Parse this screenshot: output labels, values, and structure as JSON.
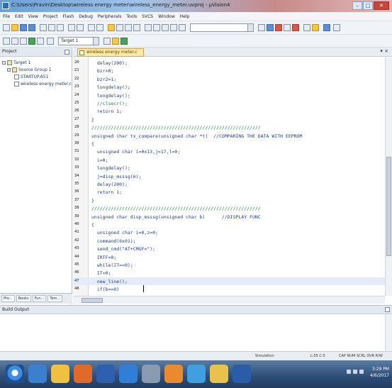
{
  "window": {
    "title": "C:\\Users\\Pravin\\Desktop\\wireless energy meter\\wireless_energy_meter.uvproj - µVision4"
  },
  "menu": [
    "File",
    "Edit",
    "View",
    "Project",
    "Flash",
    "Debug",
    "Peripherals",
    "Tools",
    "SVCS",
    "Window",
    "Help"
  ],
  "toolbar": {
    "target_combo": "Target 1"
  },
  "project": {
    "header": "Project",
    "tree": [
      {
        "label": "Target 1",
        "depth": 0
      },
      {
        "label": "Source Group 1",
        "depth": 1
      },
      {
        "label": "STARTUP.A51",
        "depth": 2
      },
      {
        "label": "wireless energy meter.c",
        "depth": 2
      }
    ],
    "tabs": [
      "Pro...",
      "Books",
      "Fun...",
      "Tem..."
    ]
  },
  "editor": {
    "tab": "wireless energy meter.c",
    "lines": [
      {
        "ln": "20",
        "text": "  delay(200);"
      },
      {
        "ln": "21",
        "text": "  bzr=0;"
      },
      {
        "ln": "22",
        "text": "  bzr2=1;"
      },
      {
        "ln": "23",
        "text": "  longdelay();"
      },
      {
        "ln": "24",
        "text": "  longdelay();"
      },
      {
        "ln": "25",
        "text": "  //clsecr();",
        "comment": true
      },
      {
        "ln": "26",
        "text": "  return 1;"
      },
      {
        "ln": "27",
        "text": "}"
      },
      {
        "ln": "28",
        "text": "/////////////////////////////////////////////////////////////",
        "comment": true
      },
      {
        "ln": "29",
        "text": "unsigned char tx_compare(unsigned char *t)  //COMPARING THE DATA WITH EEPROM",
        "comment_from": 42
      },
      {
        "ln": "30",
        "text": "{"
      },
      {
        "ln": "31",
        "text": "  unsigned char i=0x13,j=17,l=0;"
      },
      {
        "ln": "32",
        "text": "  i=0;"
      },
      {
        "ln": "33",
        "text": "  longdelay();"
      },
      {
        "ln": "34",
        "text": "  j=disp_msssg(m);"
      },
      {
        "ln": "35",
        "text": "  delay(200);"
      },
      {
        "ln": "36",
        "text": "  return 1;"
      },
      {
        "ln": "37",
        "text": "}"
      },
      {
        "ln": "38",
        "text": "/////////////////////////////////////////////////////////////",
        "comment": true
      },
      {
        "ln": "39",
        "text": "unsigned char disp_msssg(unsigned char b)      //DISPLAY FUNC",
        "comment_from": 46
      },
      {
        "ln": "40",
        "text": "{"
      },
      {
        "ln": "41",
        "text": "  unsigned char i=0,z=0;"
      },
      {
        "ln": "42",
        "text": "  command(0x01);"
      },
      {
        "ln": "43",
        "text": "  send_cmd(\"AT+CMGF=\");"
      },
      {
        "ln": "44",
        "text": "  IRTF=0;"
      },
      {
        "ln": "45",
        "text": "  while(IT==0);"
      },
      {
        "ln": "46",
        "text": "  IT=0;"
      },
      {
        "ln": "47",
        "text": "  new_line();"
      },
      {
        "ln": "48",
        "text": "  if(b==0)"
      }
    ]
  },
  "output": {
    "header": "Build Output"
  },
  "status": {
    "simulation": "Simulation",
    "position": "L:55 C:5",
    "mode": "CAP NUM SCRL OVR R/W"
  },
  "taskbar": {
    "clock_time": "3:29 PM",
    "clock_date": "4/6/2017"
  },
  "colors": {
    "code_text": "#1e3c8c",
    "comment_text": "#1a7d3a",
    "active_tab": "#ffe9a6"
  }
}
